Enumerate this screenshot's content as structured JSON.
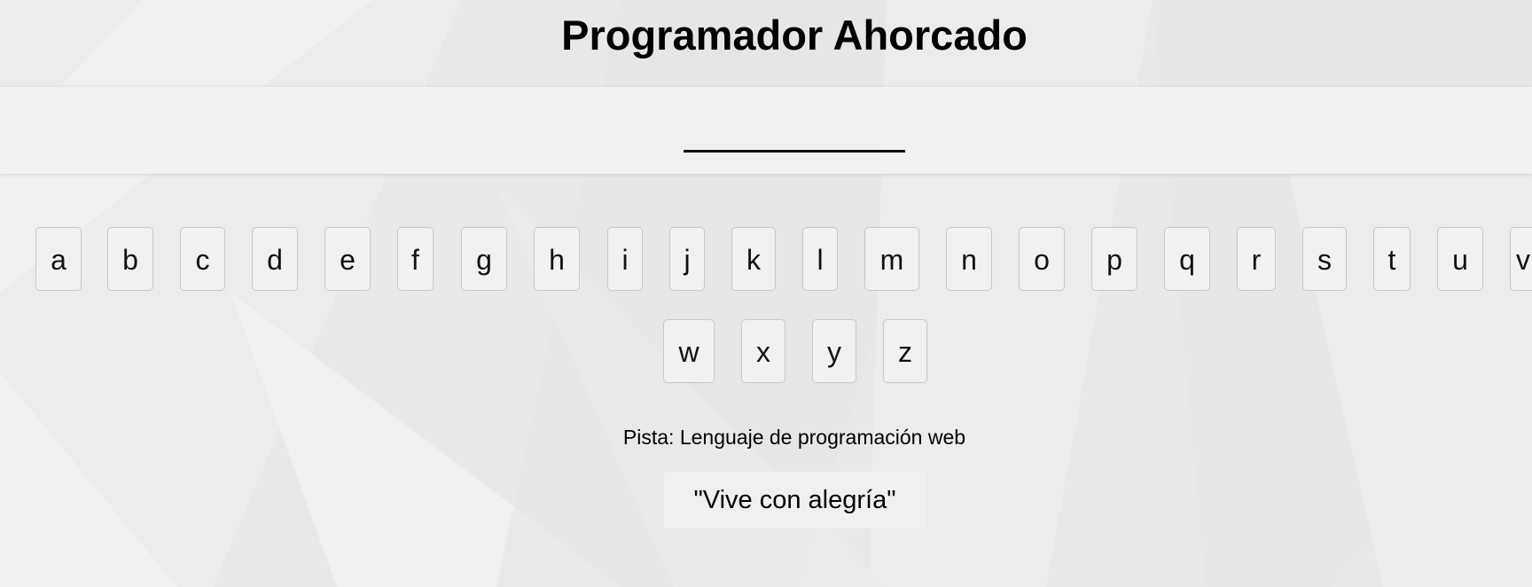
{
  "game": {
    "title": "Programador Ahorcado",
    "hint": "Pista: Lenguaje de programación web",
    "quote": "\"Vive con alegría\""
  },
  "keyboard": {
    "keys": [
      "a",
      "b",
      "c",
      "d",
      "e",
      "f",
      "g",
      "h",
      "i",
      "j",
      "k",
      "l",
      "m",
      "n",
      "o",
      "p",
      "q",
      "r",
      "s",
      "t",
      "u",
      "v",
      "w",
      "x",
      "y",
      "z"
    ]
  },
  "colors": {
    "background": "#e9e9e9",
    "key_background": "#f1f1f1",
    "key_border": "#c7c7c7",
    "text": "#000000"
  }
}
